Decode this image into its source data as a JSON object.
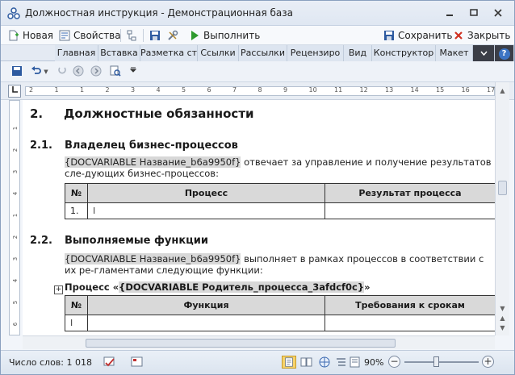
{
  "window": {
    "title": "Должностная инструкция - Демонстрационная база"
  },
  "toolbar": {
    "new_label": "Новая",
    "properties_label": "Свойства",
    "execute_label": "Выполнить",
    "save_label": "Сохранить",
    "close_label": "Закрыть"
  },
  "ribbon": {
    "tabs": [
      "Главная",
      "Вставка",
      "Разметка ст",
      "Ссылки",
      "Рассылки",
      "Рецензиро",
      "Вид",
      "Конструктор",
      "Макет"
    ],
    "help_label": "?"
  },
  "ruler": {
    "h_numbers": [
      "2",
      "1",
      "1",
      "2",
      "3",
      "4",
      "5",
      "6",
      "7",
      "8",
      "9",
      "10",
      "11",
      "12",
      "13",
      "14",
      "15",
      "16",
      "17"
    ],
    "v_numbers": [
      "1",
      "2",
      "3",
      "4",
      "1",
      "2",
      "3",
      "4",
      "5",
      "6"
    ]
  },
  "document": {
    "section_num": "2.",
    "section_title": "Должностные обязанности",
    "sub1": {
      "num": "2.1.",
      "title": "Владелец бизнес-процессов",
      "field": "{DOCVARIABLE Название_b6a9950f}",
      "text": " отвечает за управление и получение результатов сле-дующих бизнес-процессов:",
      "table_headers": [
        "№",
        "Процесс",
        "Результат процесса"
      ],
      "row_num": "1."
    },
    "sub2": {
      "num": "2.2.",
      "title": "Выполняемые функции",
      "field": "{DOCVARIABLE Название_b6a9950f}",
      "text": " выполняет в рамках процессов в соответствии с их ре-гламентами следующие функции:",
      "proc_prefix": "Процесс «",
      "proc_field": "{DOCVARIABLE Родитель_процесса_3afdcf0c}",
      "proc_suffix": "»",
      "table_headers": [
        "№",
        "Функция",
        "Требования к срокам"
      ]
    },
    "text_cursor": "I"
  },
  "status": {
    "word_count": "Число слов: 1 018",
    "zoom": "90%",
    "zoom_level_percent": 90
  },
  "colors": {
    "field_bg": "#d8d8d8",
    "table_header_bg": "#d9d9d9",
    "dark_tab": "#3b3e47"
  }
}
